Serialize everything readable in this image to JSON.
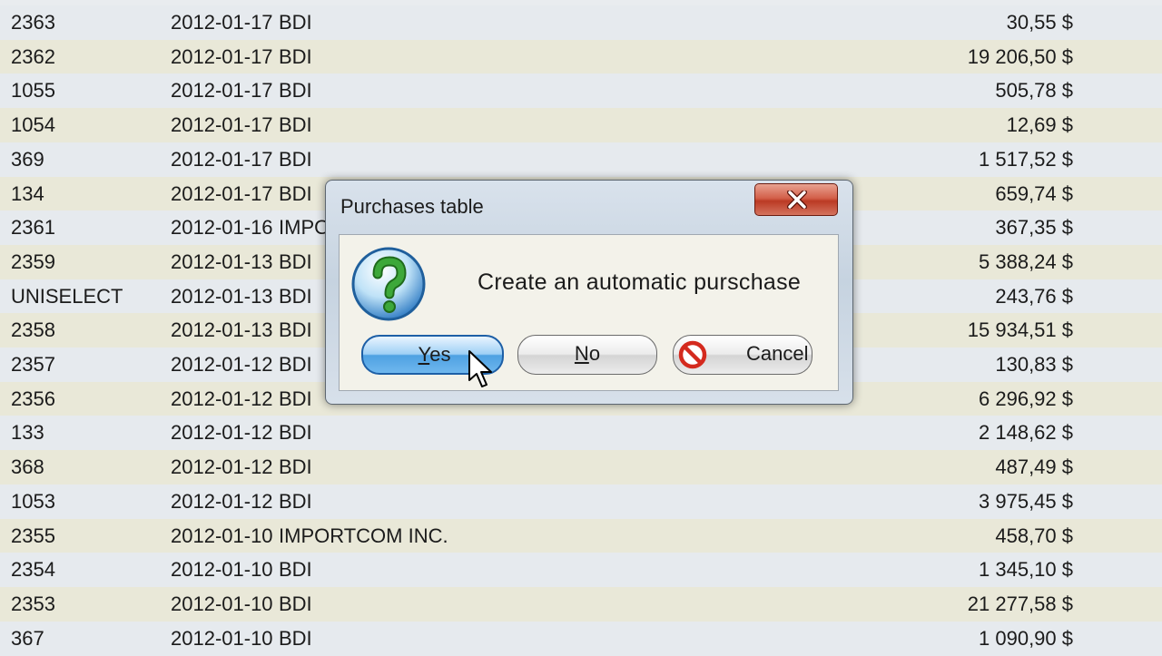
{
  "rows": [
    {
      "id": "2363",
      "date": "2012-01-17",
      "supplier": "BDI",
      "amount": "30,55 $"
    },
    {
      "id": "2362",
      "date": "2012-01-17",
      "supplier": "BDI",
      "amount": "19 206,50 $"
    },
    {
      "id": "1055",
      "date": "2012-01-17",
      "supplier": "BDI",
      "amount": "505,78 $"
    },
    {
      "id": "1054",
      "date": "2012-01-17",
      "supplier": "BDI",
      "amount": "12,69 $"
    },
    {
      "id": "369",
      "date": "2012-01-17",
      "supplier": "BDI",
      "amount": "1 517,52 $"
    },
    {
      "id": "134",
      "date": "2012-01-17",
      "supplier": "BDI",
      "amount": "659,74 $"
    },
    {
      "id": "2361",
      "date": "2012-01-16",
      "supplier": "IMPORTCOM INC.",
      "amount": "367,35 $"
    },
    {
      "id": "2359",
      "date": "2012-01-13",
      "supplier": "BDI",
      "amount": "5 388,24 $"
    },
    {
      "id": "UNISELECT",
      "date": "2012-01-13",
      "supplier": "BDI",
      "amount": "243,76 $"
    },
    {
      "id": "2358",
      "date": "2012-01-13",
      "supplier": "BDI",
      "amount": "15 934,51 $"
    },
    {
      "id": "2357",
      "date": "2012-01-12",
      "supplier": "BDI",
      "amount": "130,83 $"
    },
    {
      "id": "2356",
      "date": "2012-01-12",
      "supplier": "BDI",
      "amount": "6 296,92 $"
    },
    {
      "id": "133",
      "date": "2012-01-12",
      "supplier": "BDI",
      "amount": "2 148,62 $"
    },
    {
      "id": "368",
      "date": "2012-01-12",
      "supplier": "BDI",
      "amount": "487,49 $"
    },
    {
      "id": "1053",
      "date": "2012-01-12",
      "supplier": "BDI",
      "amount": "3 975,45 $"
    },
    {
      "id": "2355",
      "date": "2012-01-10",
      "supplier": "IMPORTCOM INC.",
      "amount": "458,70 $"
    },
    {
      "id": "2354",
      "date": "2012-01-10",
      "supplier": "BDI",
      "amount": "1 345,10 $"
    },
    {
      "id": "2353",
      "date": "2012-01-10",
      "supplier": "BDI",
      "amount": "21 277,58 $"
    },
    {
      "id": "367",
      "date": "2012-01-10",
      "supplier": "BDI",
      "amount": "1 090,90 $"
    }
  ],
  "dialog": {
    "title": "Purchases table",
    "message": "Create an automatic purschase",
    "icon": "question-icon",
    "close_icon": "close-icon",
    "buttons": {
      "yes": {
        "accel": "Y",
        "rest": "es"
      },
      "no": {
        "accel": "N",
        "rest": "o"
      },
      "cancel": {
        "label": "Cancel",
        "icon": "no-entry-icon"
      }
    }
  },
  "colors": {
    "row_odd": "#e6eaee",
    "row_even": "#e9e8d8",
    "close_red": "#c8452f",
    "yes_blue": "#4ea1e2",
    "cancel_red": "#d42a1e",
    "question_green": "#3da83a"
  }
}
